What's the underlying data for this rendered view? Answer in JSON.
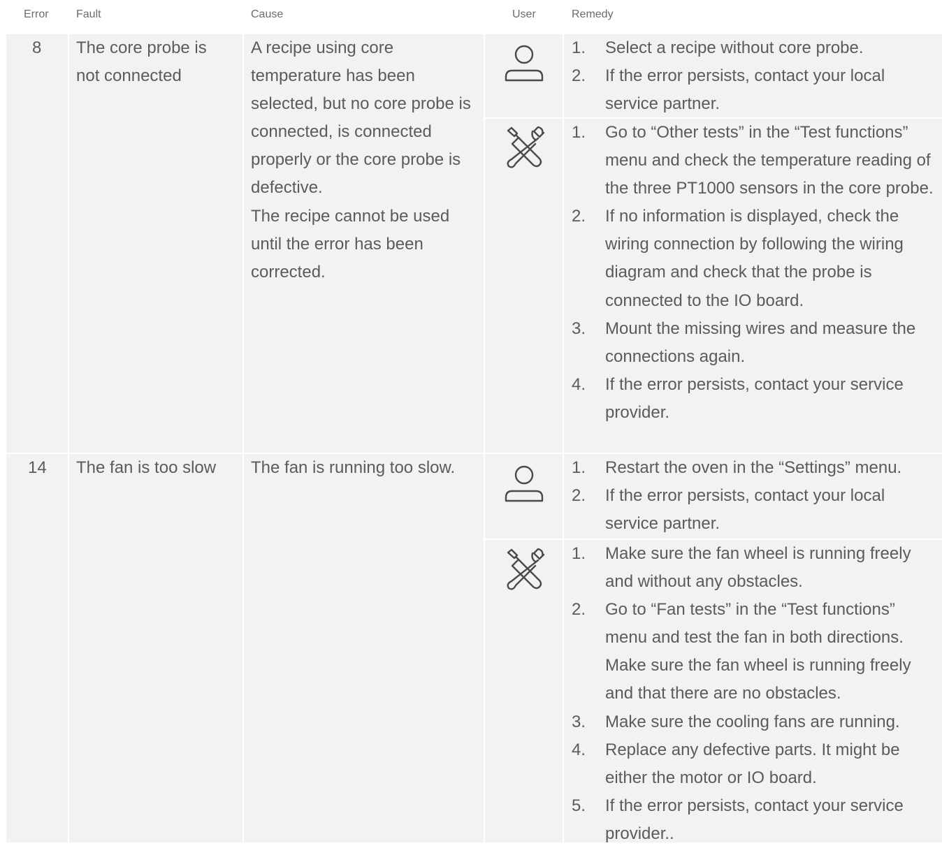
{
  "headers": {
    "error": "Error",
    "fault": "Fault",
    "cause": "Cause",
    "user": "User",
    "remedy": "Remedy"
  },
  "rows": [
    {
      "error": "8",
      "fault": "The core probe is not connected",
      "cause": "A recipe using core temperature has been selected, but no core probe is connected, is connected properly or the core probe is defective.\nThe recipe cannot be used until the error has been corrected.",
      "user_icon": "person-icon",
      "user_steps": [
        "Select a recipe without core probe.",
        "If the error persists, contact your local service partner."
      ],
      "service_icon": "tools-icon",
      "service_steps": [
        "Go to “Other tests” in the “Test functions” menu and check the temperature reading of the three PT1000 sensors in the core probe.",
        "If no information is displayed, check the wiring connection by following the wiring diagram and check that the probe is connected to the IO board.",
        "Mount the missing wires and measure the connections again.",
        "If the error persists, contact your service provider."
      ]
    },
    {
      "error": "14",
      "fault": "The fan is too slow",
      "cause": "The fan is running too slow.",
      "user_icon": "person-icon",
      "user_steps": [
        "Restart the oven in the “Settings” menu.",
        "If the error persists, contact your local service partner."
      ],
      "service_icon": "tools-icon",
      "service_steps": [
        "Make sure the fan wheel is running freely and without any obstacles.",
        "Go to “Fan tests” in the “Test functions” menu and test the fan in both directions. Make sure the fan wheel is running freely and that there are no obstacles.",
        "Make sure the cooling fans are running.",
        "Replace any defective parts. It might be either the motor or IO board.",
        "If the error persists, contact your service provider.."
      ]
    }
  ],
  "step_numbers": [
    "1.",
    "2.",
    "3.",
    "4.",
    "5."
  ]
}
